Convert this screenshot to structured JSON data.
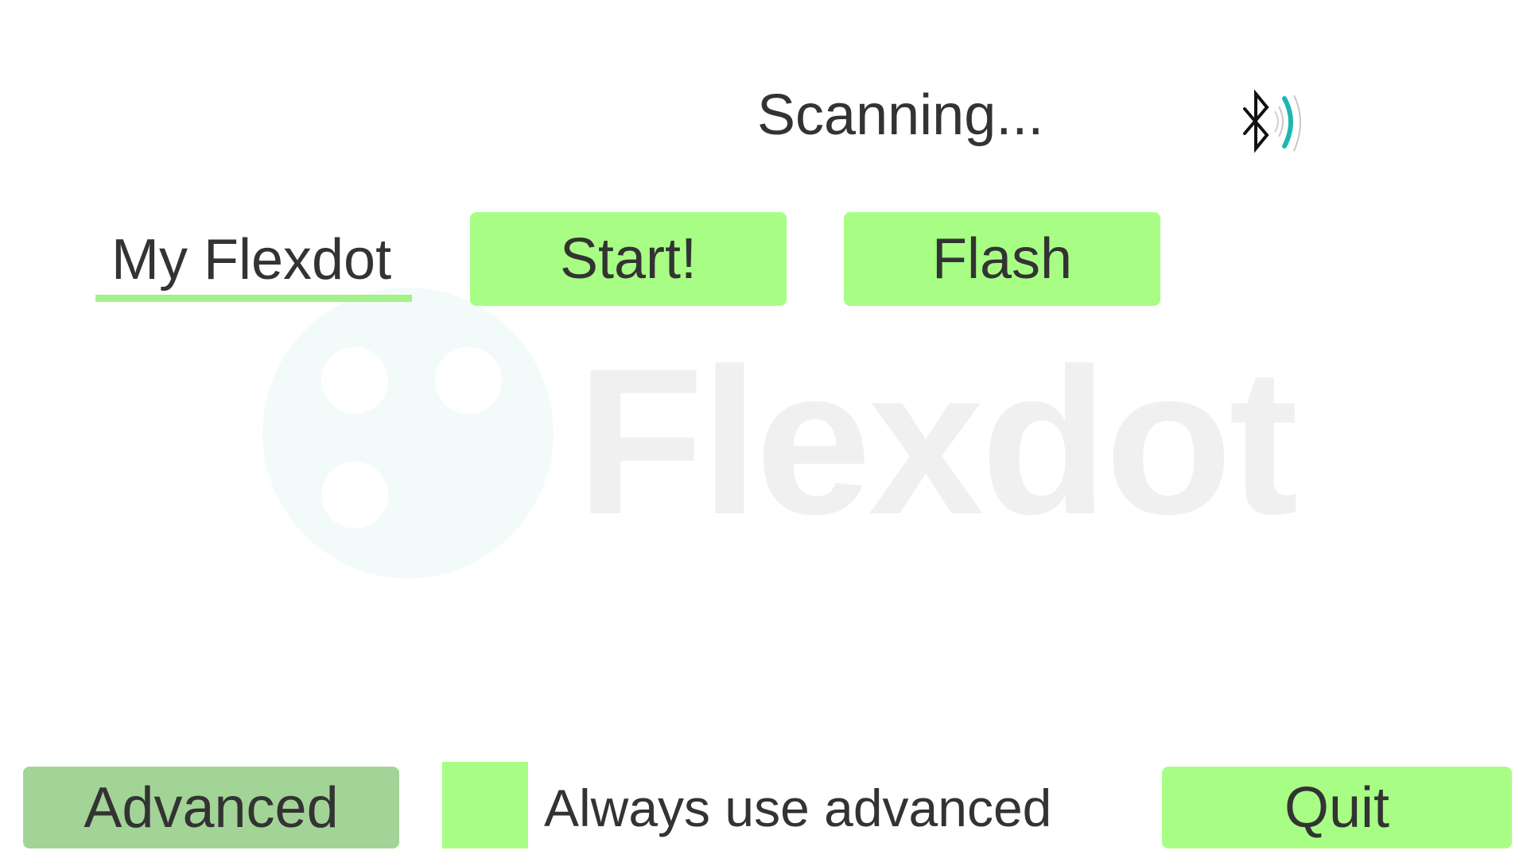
{
  "status": {
    "text": "Scanning...",
    "icon": "bluetooth-scanning-icon"
  },
  "device": {
    "name": "My Flexdot"
  },
  "buttons": {
    "start_label": "Start!",
    "flash_label": "Flash",
    "advanced_label": "Advanced",
    "quit_label": "Quit"
  },
  "advanced_option": {
    "label": "Always use advanced",
    "checked": false
  },
  "watermark": {
    "logo_text": "Flexdot"
  },
  "colors": {
    "button_green": "#a8fe84",
    "advanced_button": "#a3d497",
    "underline_green": "#a3f287",
    "signal_teal": "#1fb8b0",
    "text": "#333333"
  }
}
